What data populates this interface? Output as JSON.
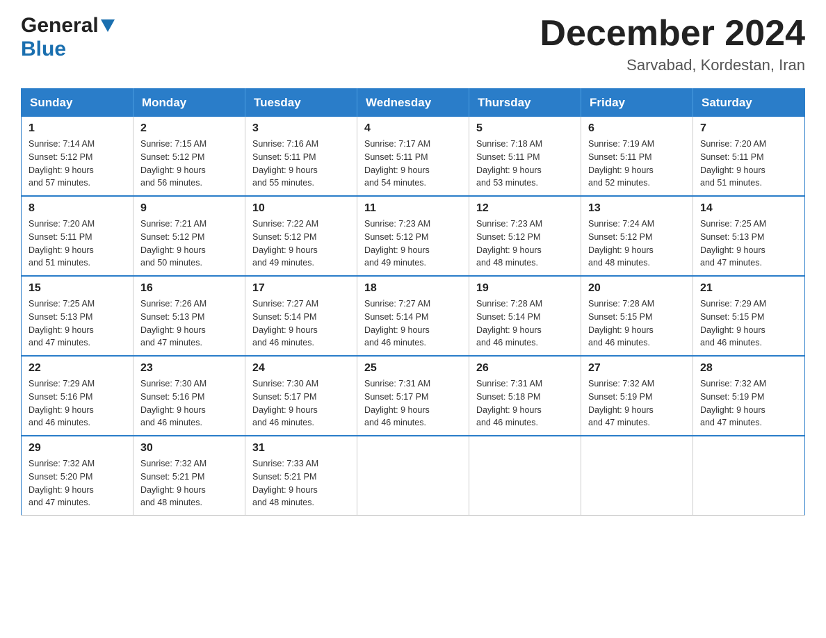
{
  "logo": {
    "general": "General",
    "blue": "Blue"
  },
  "title": {
    "month_year": "December 2024",
    "location": "Sarvabad, Kordestan, Iran"
  },
  "days_of_week": [
    "Sunday",
    "Monday",
    "Tuesday",
    "Wednesday",
    "Thursday",
    "Friday",
    "Saturday"
  ],
  "weeks": [
    [
      {
        "day": "1",
        "sunrise": "7:14 AM",
        "sunset": "5:12 PM",
        "daylight": "9 hours and 57 minutes."
      },
      {
        "day": "2",
        "sunrise": "7:15 AM",
        "sunset": "5:12 PM",
        "daylight": "9 hours and 56 minutes."
      },
      {
        "day": "3",
        "sunrise": "7:16 AM",
        "sunset": "5:11 PM",
        "daylight": "9 hours and 55 minutes."
      },
      {
        "day": "4",
        "sunrise": "7:17 AM",
        "sunset": "5:11 PM",
        "daylight": "9 hours and 54 minutes."
      },
      {
        "day": "5",
        "sunrise": "7:18 AM",
        "sunset": "5:11 PM",
        "daylight": "9 hours and 53 minutes."
      },
      {
        "day": "6",
        "sunrise": "7:19 AM",
        "sunset": "5:11 PM",
        "daylight": "9 hours and 52 minutes."
      },
      {
        "day": "7",
        "sunrise": "7:20 AM",
        "sunset": "5:11 PM",
        "daylight": "9 hours and 51 minutes."
      }
    ],
    [
      {
        "day": "8",
        "sunrise": "7:20 AM",
        "sunset": "5:11 PM",
        "daylight": "9 hours and 51 minutes."
      },
      {
        "day": "9",
        "sunrise": "7:21 AM",
        "sunset": "5:12 PM",
        "daylight": "9 hours and 50 minutes."
      },
      {
        "day": "10",
        "sunrise": "7:22 AM",
        "sunset": "5:12 PM",
        "daylight": "9 hours and 49 minutes."
      },
      {
        "day": "11",
        "sunrise": "7:23 AM",
        "sunset": "5:12 PM",
        "daylight": "9 hours and 49 minutes."
      },
      {
        "day": "12",
        "sunrise": "7:23 AM",
        "sunset": "5:12 PM",
        "daylight": "9 hours and 48 minutes."
      },
      {
        "day": "13",
        "sunrise": "7:24 AM",
        "sunset": "5:12 PM",
        "daylight": "9 hours and 48 minutes."
      },
      {
        "day": "14",
        "sunrise": "7:25 AM",
        "sunset": "5:13 PM",
        "daylight": "9 hours and 47 minutes."
      }
    ],
    [
      {
        "day": "15",
        "sunrise": "7:25 AM",
        "sunset": "5:13 PM",
        "daylight": "9 hours and 47 minutes."
      },
      {
        "day": "16",
        "sunrise": "7:26 AM",
        "sunset": "5:13 PM",
        "daylight": "9 hours and 47 minutes."
      },
      {
        "day": "17",
        "sunrise": "7:27 AM",
        "sunset": "5:14 PM",
        "daylight": "9 hours and 46 minutes."
      },
      {
        "day": "18",
        "sunrise": "7:27 AM",
        "sunset": "5:14 PM",
        "daylight": "9 hours and 46 minutes."
      },
      {
        "day": "19",
        "sunrise": "7:28 AM",
        "sunset": "5:14 PM",
        "daylight": "9 hours and 46 minutes."
      },
      {
        "day": "20",
        "sunrise": "7:28 AM",
        "sunset": "5:15 PM",
        "daylight": "9 hours and 46 minutes."
      },
      {
        "day": "21",
        "sunrise": "7:29 AM",
        "sunset": "5:15 PM",
        "daylight": "9 hours and 46 minutes."
      }
    ],
    [
      {
        "day": "22",
        "sunrise": "7:29 AM",
        "sunset": "5:16 PM",
        "daylight": "9 hours and 46 minutes."
      },
      {
        "day": "23",
        "sunrise": "7:30 AM",
        "sunset": "5:16 PM",
        "daylight": "9 hours and 46 minutes."
      },
      {
        "day": "24",
        "sunrise": "7:30 AM",
        "sunset": "5:17 PM",
        "daylight": "9 hours and 46 minutes."
      },
      {
        "day": "25",
        "sunrise": "7:31 AM",
        "sunset": "5:17 PM",
        "daylight": "9 hours and 46 minutes."
      },
      {
        "day": "26",
        "sunrise": "7:31 AM",
        "sunset": "5:18 PM",
        "daylight": "9 hours and 46 minutes."
      },
      {
        "day": "27",
        "sunrise": "7:32 AM",
        "sunset": "5:19 PM",
        "daylight": "9 hours and 47 minutes."
      },
      {
        "day": "28",
        "sunrise": "7:32 AM",
        "sunset": "5:19 PM",
        "daylight": "9 hours and 47 minutes."
      }
    ],
    [
      {
        "day": "29",
        "sunrise": "7:32 AM",
        "sunset": "5:20 PM",
        "daylight": "9 hours and 47 minutes."
      },
      {
        "day": "30",
        "sunrise": "7:32 AM",
        "sunset": "5:21 PM",
        "daylight": "9 hours and 48 minutes."
      },
      {
        "day": "31",
        "sunrise": "7:33 AM",
        "sunset": "5:21 PM",
        "daylight": "9 hours and 48 minutes."
      },
      null,
      null,
      null,
      null
    ]
  ],
  "labels": {
    "sunrise": "Sunrise: ",
    "sunset": "Sunset: ",
    "daylight": "Daylight: "
  }
}
